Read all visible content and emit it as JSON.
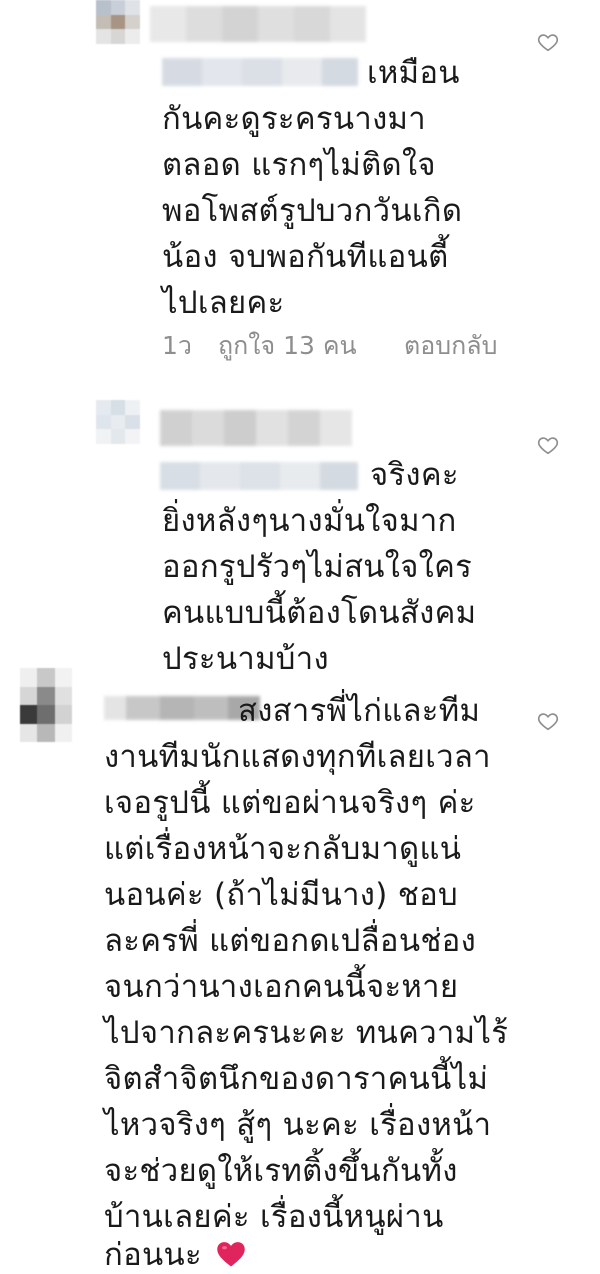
{
  "comments": [
    {
      "lines": [
        "เหมือน",
        "กันคะดูระครนางมา",
        "ตลอด แรกๆไม่ติดใจ",
        "พอโพสต์รูปบวกวันเกิด",
        "น้อง จบพอกันทีแอนตี้",
        "ไปเลยคะ"
      ],
      "time": "1ว",
      "likes": "ถูกใจ 13 คน",
      "reply": "ตอบกลับ"
    },
    {
      "lines": [
        "จริงคะ",
        "ยิ่งหลังๆนางมั่นใจมาก",
        "ออกรูปรัวๆไม่สนใจใคร",
        "คนแบบนี้ต้องโดนสังคม",
        "ประนามบ้าง"
      ]
    },
    {
      "lines": [
        "สงสารพี่ไก่และทีม",
        "งานทีมนักแสดงทุกทีเลยเวลา",
        "เจอรูปนี้ แต่ขอผ่านจริงๆ ค่ะ",
        "แต่เรื่องหน้าจะกลับมาดูแน่",
        "นอนค่ะ (ถ้าไม่มีนาง) ชอบ",
        "ละครพี่ แต่ขอกดเปลื่อนช่อง",
        "จนกว่านางเอกคนนี้จะหาย",
        "ไปจากละครนะคะ ทนความไร้",
        "จิตสำจิตนึกของดาราคนนี้ไม่",
        "ไหวจริงๆ สู้ๆ นะคะ เรื่องหน้า",
        "จะช่วยดูให้เรทติ้งขึ้นกันทั้ง",
        "บ้านเลยค่ะ เรื่องนี้หนูผ่าน",
        "ก่อนนะ"
      ]
    }
  ],
  "icons": {
    "like": "heart-outline-icon",
    "emoji": "red-heart-emoji"
  },
  "colors": {
    "text": "#1a1a1a",
    "meta": "#8e8e8e",
    "emoji": "#e0245e"
  }
}
